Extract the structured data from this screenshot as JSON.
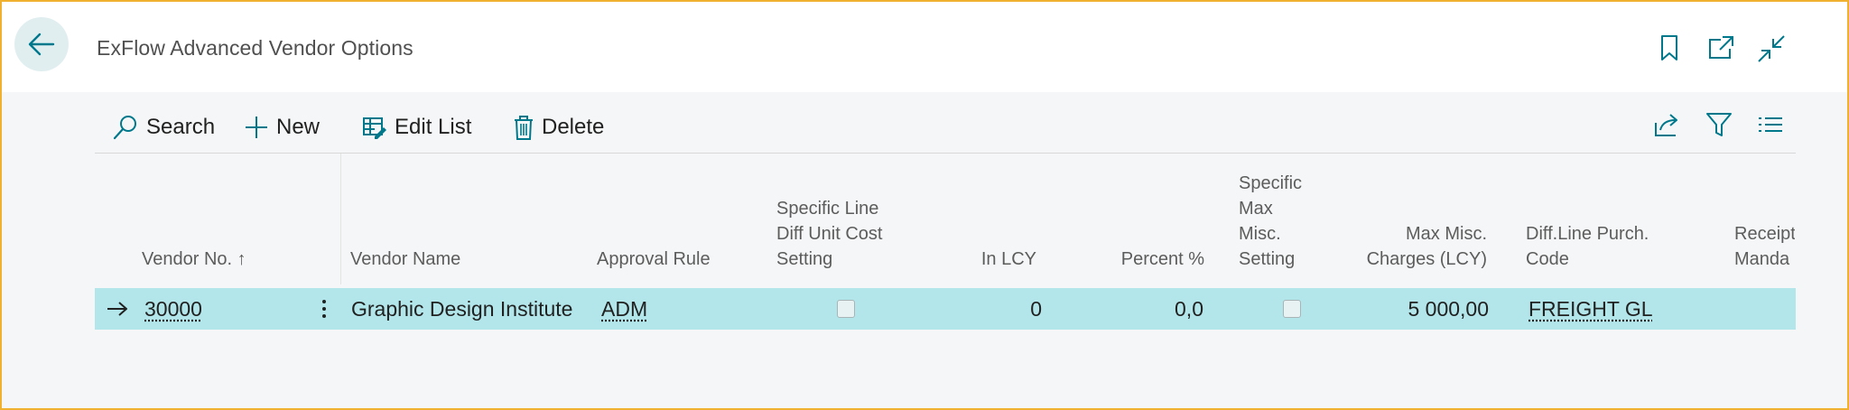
{
  "header": {
    "title": "ExFlow Advanced Vendor Options"
  },
  "toolbar": {
    "search_label": "Search",
    "new_label": "New",
    "edit_list_label": "Edit List",
    "delete_label": "Delete"
  },
  "columns": {
    "vendor_no": "Vendor No. ↑",
    "vendor_name": "Vendor Name",
    "approval_rule": "Approval Rule",
    "line_diff_1": "Specific Line",
    "line_diff_2": "Diff Unit Cost",
    "line_diff_3": "Setting",
    "in_lcy": "In LCY",
    "percent": "Percent %",
    "max_misc_1": "Specific",
    "max_misc_2": "Max",
    "max_misc_3": "Misc.",
    "max_misc_4": "Setting",
    "max_charges_1": "Max Misc.",
    "max_charges_2": "Charges (LCY)",
    "diff_code_1": "Diff.Line Purch.",
    "diff_code_2": "Code",
    "receipt_1": "Receipt",
    "receipt_2": "Manda"
  },
  "rows": [
    {
      "vendor_no": "30000",
      "vendor_name": "Graphic Design Institute",
      "approval_rule": "ADM",
      "specific_line_diff": false,
      "in_lcy": "0",
      "percent": "0,0",
      "specific_max_misc": false,
      "max_misc_charges": "5 000,00",
      "diff_line_code": "FREIGHT GL"
    }
  ],
  "colors": {
    "accent": "#00788c",
    "selected_row": "#b2e6ea",
    "frame_border": "#f0b030"
  }
}
